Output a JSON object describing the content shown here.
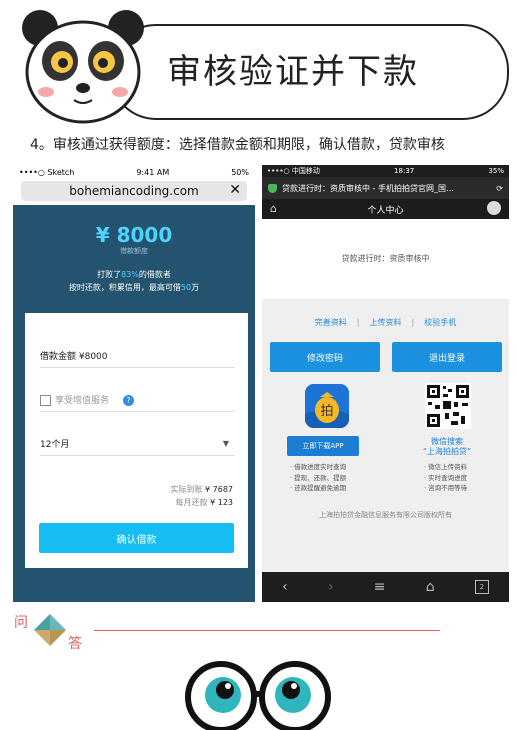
{
  "banner": {
    "title": "审核验证并下款"
  },
  "caption": "4。审核通过获得额度：选择借款金额和期限，确认借款，贷款审核",
  "left_phone": {
    "status_bar": {
      "carrier": "••••○ Sketch",
      "time": "9:41 AM",
      "battery": "50%"
    },
    "url": "bohemiancoding.com",
    "amount": "¥ 8000",
    "amount_label": "借款额度",
    "beat_prefix": "打败了",
    "beat_percent": "83%",
    "beat_suffix": "的借款者",
    "line2_prefix": "按时还款，积累信用，最高可借",
    "line2_value": "50",
    "line2_suffix": "万",
    "loan_field": "借款金额 ¥8000",
    "addon_service": "享受增值服务",
    "term": "12个月",
    "actual_label": "实际到账",
    "actual_value": "¥ 7687",
    "monthly_label": "每月还款",
    "monthly_value": "¥ 123",
    "confirm_button": "确认借款"
  },
  "right_phone": {
    "status_bar": {
      "carrier": "••••○ 中国移动",
      "time": "18:37",
      "battery": "35%"
    },
    "tab_title": "贷款进行时：资质审核中 - 手机拍拍贷官网_国…",
    "nav_title": "个人中心",
    "status_text": "贷款进行时：资质审核中",
    "link_complete": "完善资料",
    "link_upload": "上传资料",
    "link_verify": "校验手机",
    "separator": "|",
    "btn_change_pwd": "修改密码",
    "btn_logout": "退出登录",
    "download_button": "立即下载APP",
    "app_features": [
      "· 借款进度实时查询",
      "· 提现、还款、提额",
      "· 还款提醒避免逾期"
    ],
    "wechat_line1": "微信搜索",
    "wechat_line2": "“上海拍拍贷”",
    "wechat_features": [
      "· 微信上传资料",
      "· 实时查询进度",
      "· 咨询不用等待"
    ],
    "copyright": "上海拍拍贷金融信息服务有限公司版权所有",
    "tab_count": "2"
  },
  "qa": {
    "question": "问",
    "answer": "答"
  },
  "colors": {
    "accent_blue": "#1b92e0",
    "dark_teal": "#23536e",
    "cyan": "#16bdf2",
    "qa_red": "#e06060"
  }
}
